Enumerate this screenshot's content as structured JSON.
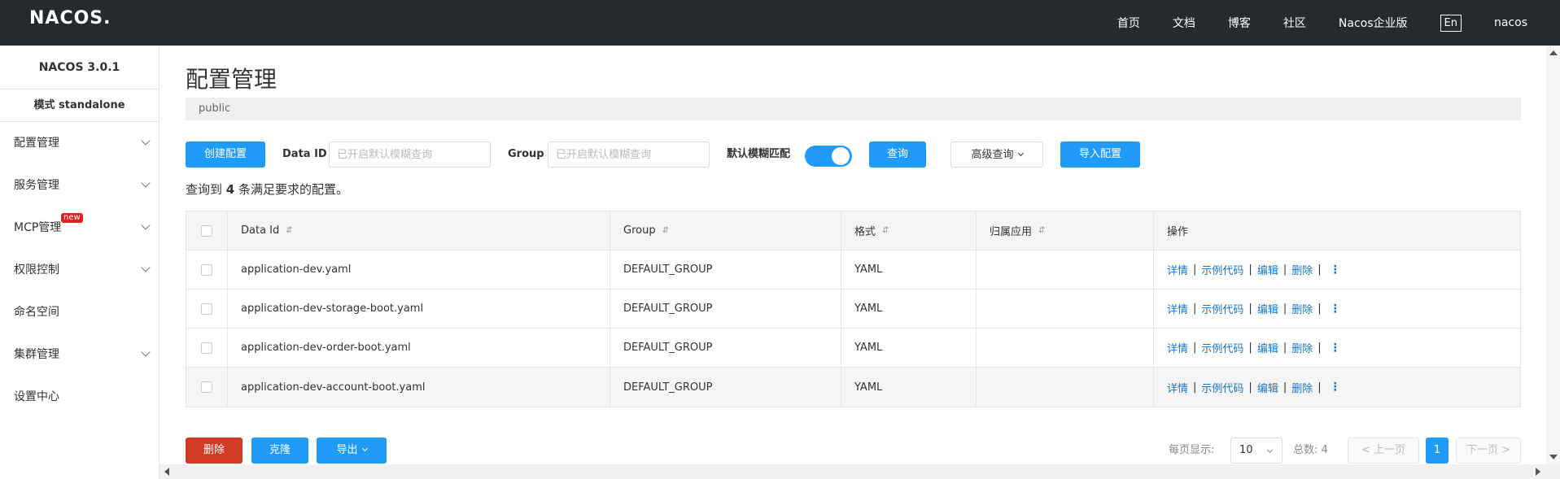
{
  "topbar": {
    "logo": "NACOS.",
    "nav": [
      "首页",
      "文档",
      "博客",
      "社区",
      "Nacos企业版"
    ],
    "lang": "En",
    "user": "nacos"
  },
  "sidebar": {
    "version": "NACOS 3.0.1",
    "mode": "模式 standalone",
    "items": [
      {
        "label": "配置管理",
        "expandable": true
      },
      {
        "label": "服务管理",
        "expandable": true
      },
      {
        "label": "MCP管理",
        "expandable": true,
        "badge": "new"
      },
      {
        "label": "权限控制",
        "expandable": true
      },
      {
        "label": "命名空间",
        "expandable": false
      },
      {
        "label": "集群管理",
        "expandable": true
      },
      {
        "label": "设置中心",
        "expandable": false
      }
    ]
  },
  "main": {
    "title": "配置管理",
    "namespace": "public",
    "create_button": "创建配置",
    "dataid_label": "Data ID",
    "dataid_placeholder": "已开启默认模糊查询",
    "group_label": "Group",
    "group_placeholder": "已开启默认模糊查询",
    "fuzzy_label": "默认模糊匹配",
    "fuzzy_enabled": true,
    "search_button": "查询",
    "advanced_button": "高级查询",
    "import_button": "导入配置",
    "result": {
      "prefix": "查询到 ",
      "count": "4",
      "suffix": " 条满足要求的配置。"
    }
  },
  "table": {
    "headers": [
      "Data Id",
      "Group",
      "格式",
      "归属应用",
      "操作"
    ],
    "rows": [
      {
        "data_id": "application-dev.yaml",
        "group": "DEFAULT_GROUP",
        "format": "YAML",
        "app": ""
      },
      {
        "data_id": "application-dev-storage-boot.yaml",
        "group": "DEFAULT_GROUP",
        "format": "YAML",
        "app": ""
      },
      {
        "data_id": "application-dev-order-boot.yaml",
        "group": "DEFAULT_GROUP",
        "format": "YAML",
        "app": ""
      },
      {
        "data_id": "application-dev-account-boot.yaml",
        "group": "DEFAULT_GROUP",
        "format": "YAML",
        "app": ""
      }
    ],
    "ops": [
      "详情",
      "示例代码",
      "编辑",
      "删除"
    ],
    "sep": "|",
    "more": "⋮",
    "sort_icon": "⇵"
  },
  "bottom": {
    "delete_button": "删除",
    "clone_button": "克隆",
    "export_button": "导出",
    "page_size_label": "每页显示:",
    "page_size": "10",
    "total_label": "总数: 4",
    "prev": "< 上一页",
    "current_page": "1",
    "next": "下一页 >"
  },
  "colors": {
    "primary": "#209bfa",
    "danger": "#d23c26",
    "topbar": "#252a2f",
    "link": "#1a76c4"
  }
}
